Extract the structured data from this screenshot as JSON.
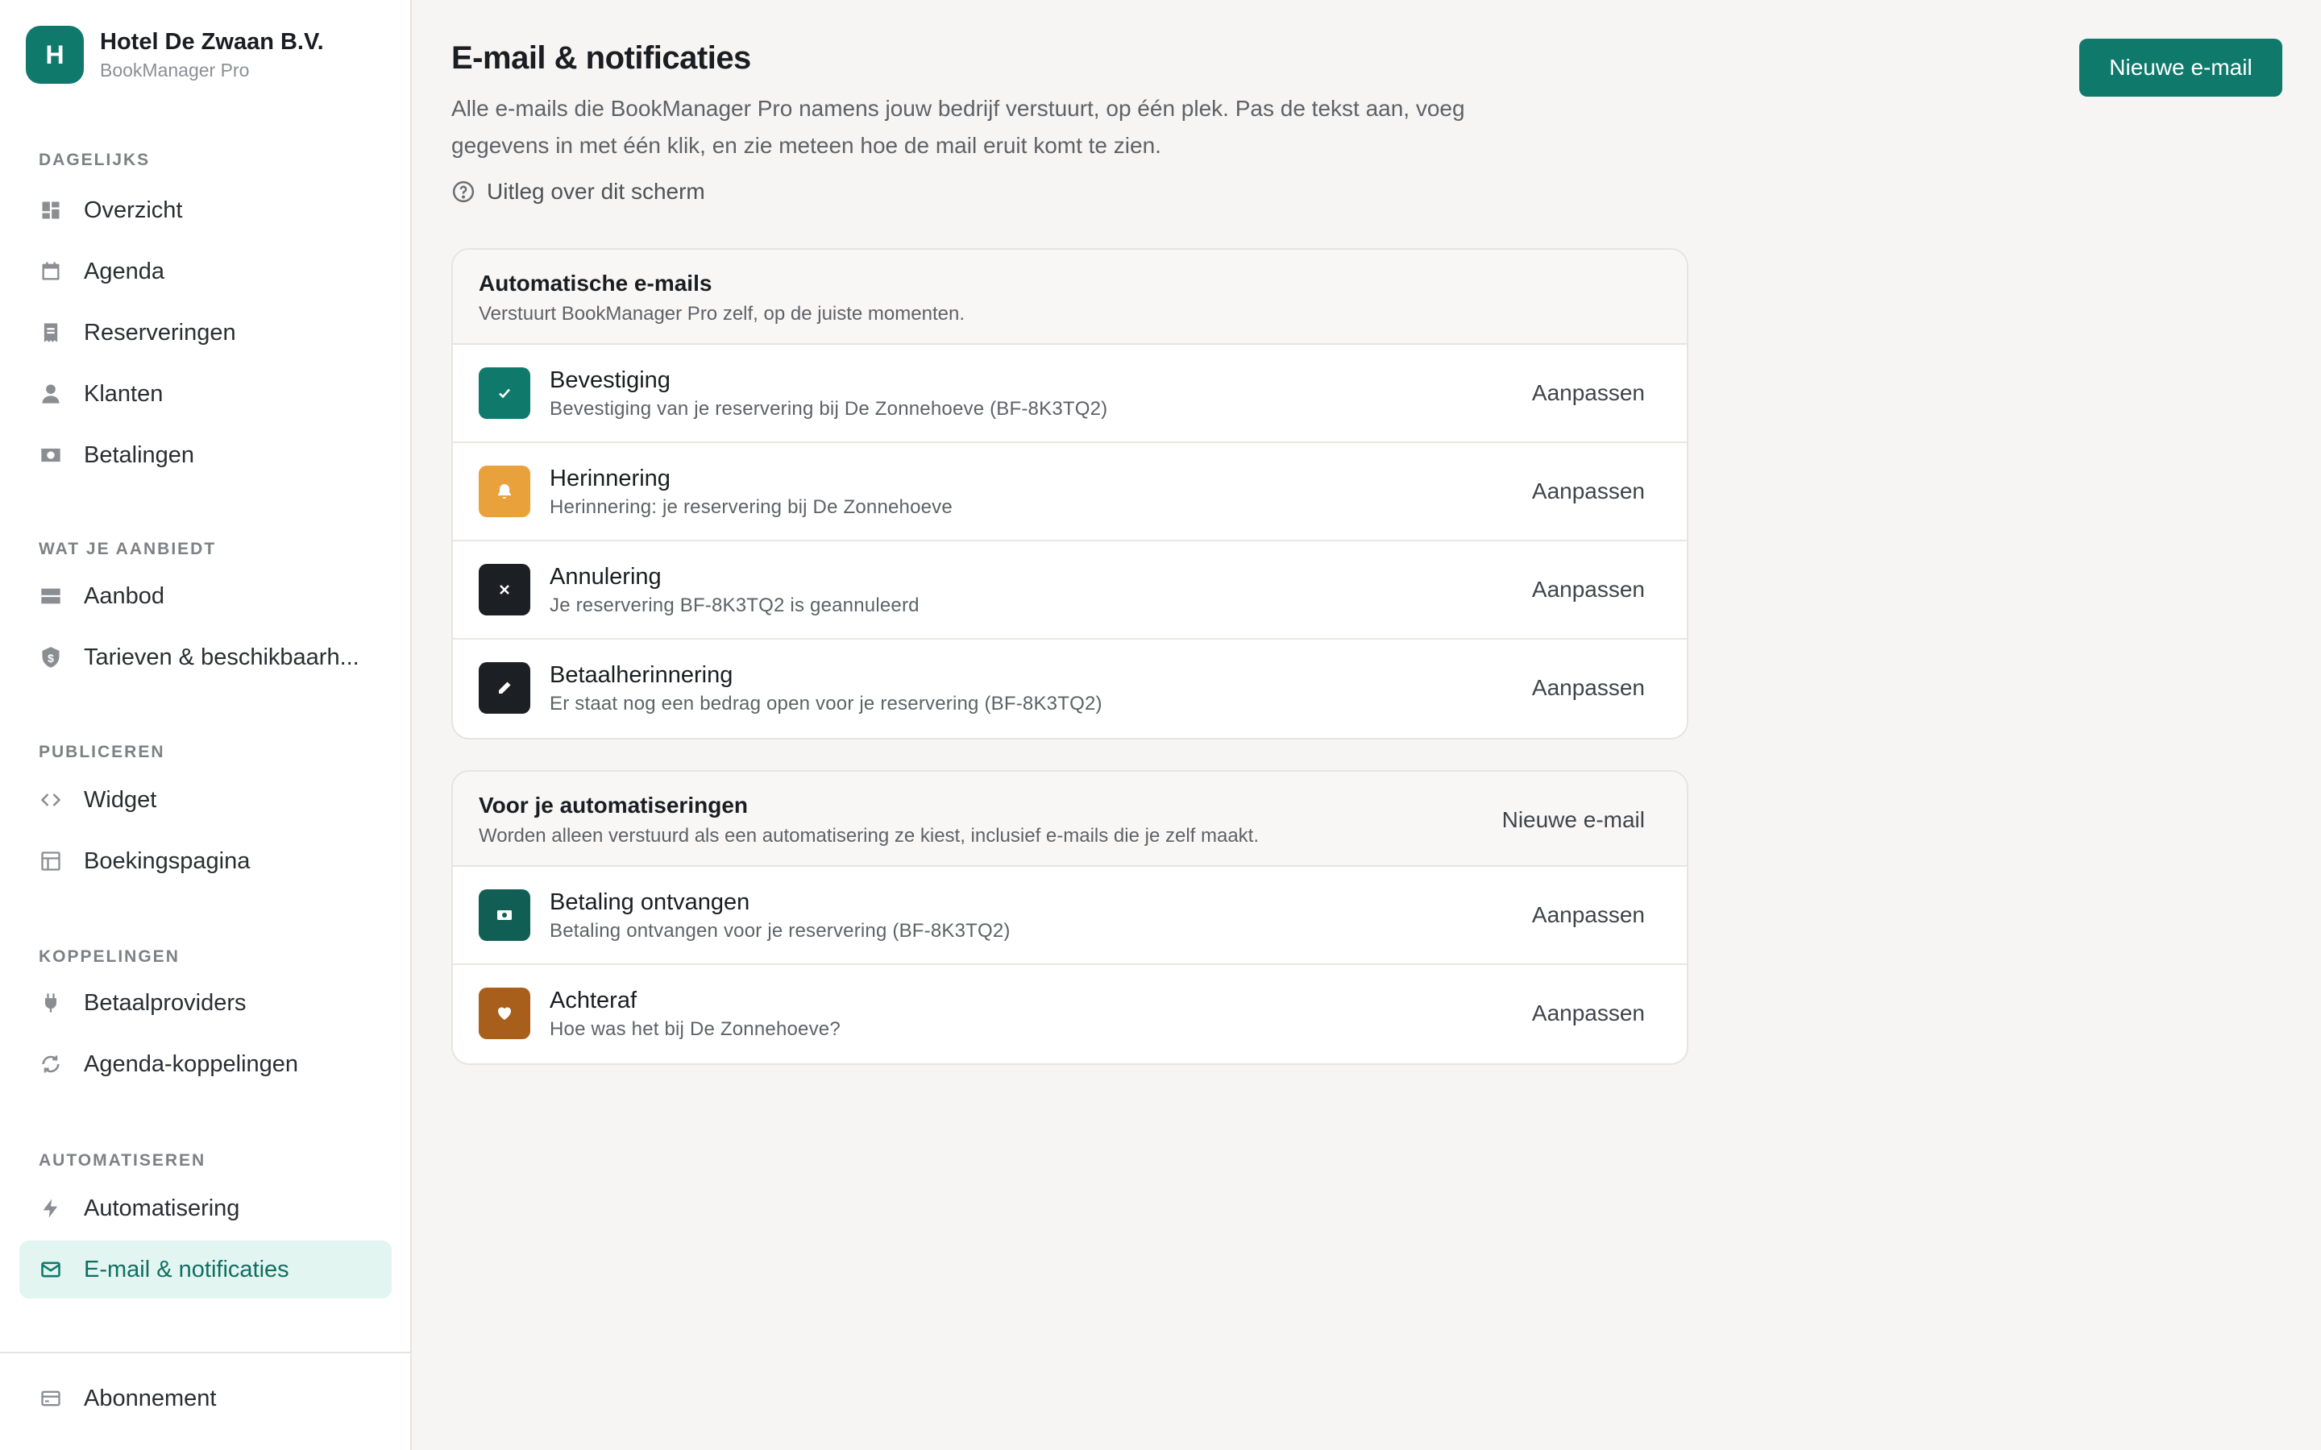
{
  "brand": {
    "initial": "H",
    "name": "Hotel De Zwaan B.V.",
    "product": "BookManager Pro"
  },
  "colors": {
    "accent": "#0f7a6c",
    "accent_light": "#e3f5f1",
    "amber": "#e9a23b",
    "dark": "#1c1f23",
    "teal_dark": "#115e55",
    "brown": "#a85f1c"
  },
  "sidebar": {
    "sections": [
      {
        "heading": "DAGELIJKS",
        "items": [
          {
            "label": "Overzicht",
            "icon": "dashboard-icon"
          },
          {
            "label": "Agenda",
            "icon": "calendar-icon"
          },
          {
            "label": "Reserveringen",
            "icon": "receipt-icon"
          },
          {
            "label": "Klanten",
            "icon": "user-icon"
          },
          {
            "label": "Betalingen",
            "icon": "cash-icon"
          }
        ]
      },
      {
        "heading": "WAT JE AANBIEDT",
        "items": [
          {
            "label": "Aanbod",
            "icon": "rows-icon"
          },
          {
            "label": "Tarieven & beschikbaarh...",
            "icon": "dollar-shield-icon"
          }
        ]
      },
      {
        "heading": "PUBLICEREN",
        "items": [
          {
            "label": "Widget",
            "icon": "code-icon"
          },
          {
            "label": "Boekingspagina",
            "icon": "layout-icon"
          }
        ]
      },
      {
        "heading": "KOPPELINGEN",
        "items": [
          {
            "label": "Betaalproviders",
            "icon": "plug-icon"
          },
          {
            "label": "Agenda-koppelingen",
            "icon": "sync-icon"
          }
        ]
      },
      {
        "heading": "AUTOMATISEREN",
        "items": [
          {
            "label": "Automatisering",
            "icon": "bolt-icon"
          },
          {
            "label": "E-mail & notificaties",
            "icon": "mail-icon"
          }
        ]
      }
    ],
    "footer": {
      "label": "Abonnement",
      "icon": "card-icon"
    }
  },
  "header": {
    "title": "E-mail & notificaties",
    "description": "Alle e-mails die BookManager Pro namens jouw bedrijf verstuurt, op één plek. Pas de tekst aan, voeg gegevens in met één klik, en zie meteen hoe de mail eruit komt te zien.",
    "help_link": "Uitleg over dit scherm",
    "new_button": "Nieuwe e-mail"
  },
  "automatic": {
    "title": "Automatische e-mails",
    "subtitle": "Verstuurt BookManager Pro zelf, op de juiste momenten.",
    "items": [
      {
        "title": "Bevestiging",
        "subject": "Bevestiging van je reservering bij De Zonnehoeve (BF-8K3TQ2)",
        "action": "Aanpassen",
        "icon": "check-icon"
      },
      {
        "title": "Herinnering",
        "subject": "Herinnering: je reservering bij De Zonnehoeve",
        "action": "Aanpassen",
        "icon": "bell-icon"
      },
      {
        "title": "Annulering",
        "subject": "Je reservering BF-8K3TQ2 is geannuleerd",
        "action": "Aanpassen",
        "icon": "x-icon"
      },
      {
        "title": "Betaalherinnering",
        "subject": "Er staat nog een bedrag open voor je reservering (BF-8K3TQ2)",
        "action": "Aanpassen",
        "icon": "pencil-icon"
      }
    ]
  },
  "automations": {
    "title": "Voor je automatiseringen",
    "subtitle": "Worden alleen verstuurd als een automatisering ze kiest, inclusief e-mails die je zelf maakt.",
    "action": "Nieuwe e-mail",
    "items": [
      {
        "title": "Betaling ontvangen",
        "subject": "Betaling ontvangen voor je reservering (BF-8K3TQ2)",
        "action": "Aanpassen",
        "icon": "banknote-icon"
      },
      {
        "title": "Achteraf",
        "subject": "Hoe was het bij De Zonnehoeve?",
        "action": "Aanpassen",
        "icon": "heart-icon"
      }
    ]
  }
}
